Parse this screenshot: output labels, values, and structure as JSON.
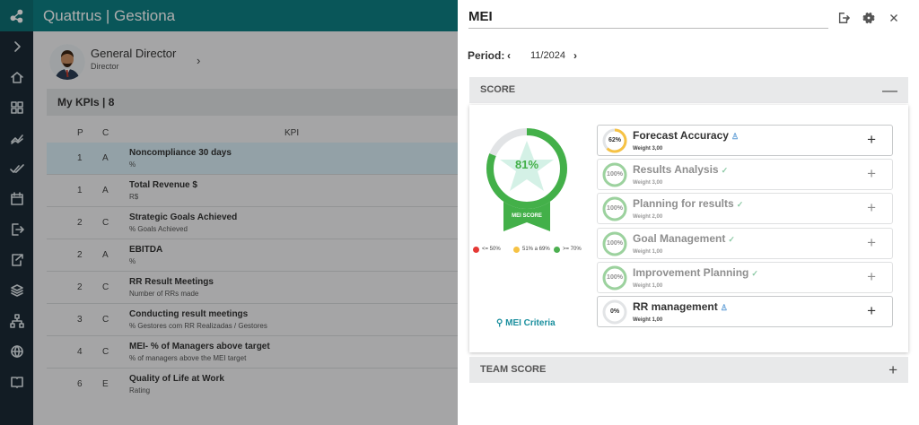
{
  "app": {
    "title": "Quattrus | Gestiona"
  },
  "rail": {
    "icons": [
      "chevron-right-icon",
      "home-icon",
      "dashboard-icon",
      "chart-icon",
      "check-icon",
      "calendar-icon",
      "exit-icon",
      "export-icon",
      "layers-icon",
      "hierarchy-icon",
      "globe-icon",
      "book-icon"
    ]
  },
  "profile": {
    "name": "General Director",
    "role": "Director"
  },
  "kpis": {
    "header": "My KPIs | 8",
    "columns": {
      "p": "P",
      "c": "C",
      "kpi": "KPI"
    },
    "rows": [
      {
        "p": "1",
        "c": "A",
        "title": "Noncompliance 30 days",
        "sub": "%"
      },
      {
        "p": "1",
        "c": "A",
        "title": "Total Revenue $",
        "sub": "R$"
      },
      {
        "p": "2",
        "c": "C",
        "title": "Strategic Goals Achieved",
        "sub": "% Goals Achieved"
      },
      {
        "p": "2",
        "c": "A",
        "title": "EBITDA",
        "sub": "%"
      },
      {
        "p": "2",
        "c": "C",
        "title": "RR Result Meetings",
        "sub": "Number of RRs made"
      },
      {
        "p": "3",
        "c": "C",
        "title": "Conducting result meetings",
        "sub": "% Gestores com RR Realizadas / Gestores"
      },
      {
        "p": "4",
        "c": "C",
        "title": "MEI- % of Managers above target",
        "sub": "% of managers above the MEI target"
      },
      {
        "p": "6",
        "c": "E",
        "title": "Quality of Life at Work",
        "sub": "Rating"
      }
    ]
  },
  "drawer": {
    "title": "MEI",
    "period_label": "Period:",
    "period_value": "11/2024",
    "prev": "‹",
    "next": "›",
    "score_section": "SCORE",
    "score_toggle": "—",
    "team_section": "TEAM SCORE",
    "team_toggle": "+",
    "gauge": {
      "value": "81%",
      "fraction": 0.81,
      "label": "MEI SCORE"
    },
    "legend": [
      {
        "text": "<= 50%",
        "color": "#e53935"
      },
      {
        "text": "51% a 69%",
        "color": "#f6c244"
      },
      {
        "text": ">= 70%",
        "color": "#4caf50"
      }
    ],
    "criteria": "MEI Criteria",
    "items": [
      {
        "name": "Forecast Accuracy",
        "weight": "Weight 3,00",
        "pct": "62%",
        "fraction": 0.62,
        "color": "#f6c244",
        "faded": false,
        "status_icon": "person-icon"
      },
      {
        "name": "Results Analysis",
        "weight": "Weight 3,00",
        "pct": "100%",
        "fraction": 1.0,
        "color": "#4caf50",
        "faded": true,
        "status_icon": "check-circle-icon"
      },
      {
        "name": "Planning for results",
        "weight": "Weight 2,00",
        "pct": "100%",
        "fraction": 1.0,
        "color": "#4caf50",
        "faded": true,
        "status_icon": "check-circle-icon"
      },
      {
        "name": "Goal Management",
        "weight": "Weight 1,00",
        "pct": "100%",
        "fraction": 1.0,
        "color": "#4caf50",
        "faded": true,
        "status_icon": "check-circle-icon"
      },
      {
        "name": "Improvement Planning",
        "weight": "Weight 1,00",
        "pct": "100%",
        "fraction": 1.0,
        "color": "#4caf50",
        "faded": true,
        "status_icon": "check-circle-icon"
      },
      {
        "name": "RR management",
        "weight": "Weight 1,00",
        "pct": "0%",
        "fraction": 0.0,
        "color": "#4caf50",
        "faded": false,
        "status_icon": "person-icon"
      }
    ],
    "plus": "+"
  }
}
